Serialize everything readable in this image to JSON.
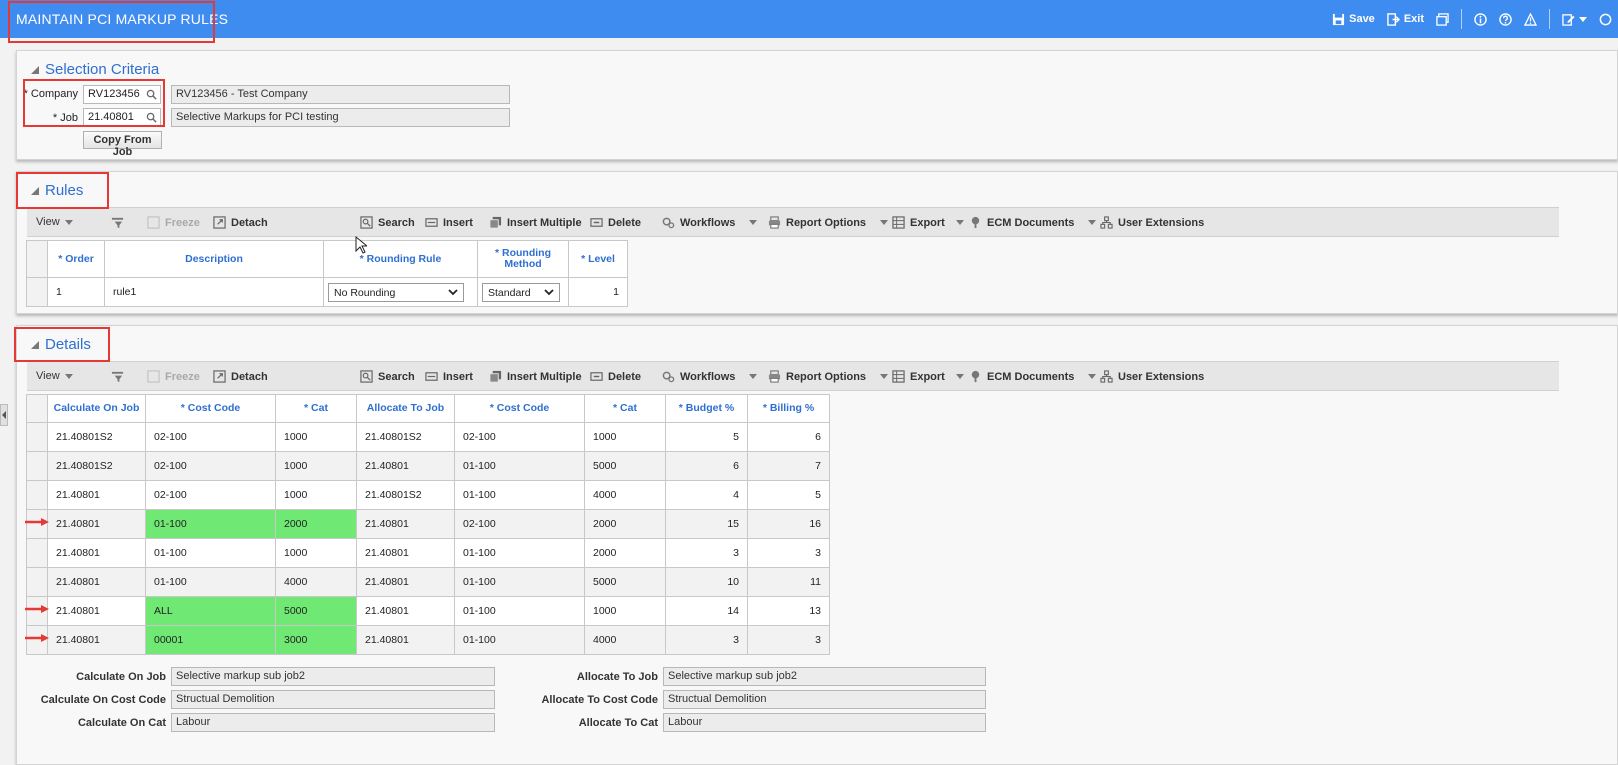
{
  "window": {
    "title": "MAINTAIN PCI MARKUP RULES",
    "actions": {
      "save": "Save",
      "exit": "Exit"
    }
  },
  "selection": {
    "title": "Selection Criteria",
    "company_label": "* Company",
    "company_value": "RV123456",
    "company_desc": "RV123456 - Test Company",
    "job_label": "* Job",
    "job_value": "21.40801",
    "job_desc": "Selective Markups for PCI testing",
    "copy_button": "Copy From Job"
  },
  "toolbar": {
    "view": "View",
    "freeze": "Freeze",
    "detach": "Detach",
    "search": "Search",
    "insert": "Insert",
    "insert_multiple": "Insert Multiple",
    "delete": "Delete",
    "workflows": "Workflows",
    "report_options": "Report Options",
    "export": "Export",
    "ecm_documents": "ECM Documents",
    "user_extensions": "User Extensions"
  },
  "rules": {
    "title": "Rules",
    "columns": [
      "* Order",
      "Description",
      "* Rounding Rule",
      "* Rounding Method",
      "* Level"
    ],
    "rows": [
      {
        "order": "1",
        "description": "rule1",
        "rounding_rule": "No Rounding",
        "rounding_method": "Standard",
        "level": "1"
      }
    ]
  },
  "details": {
    "title": "Details",
    "columns": [
      "Calculate On Job",
      "* Cost Code",
      "* Cat",
      "Allocate To Job",
      "* Cost Code",
      "* Cat",
      "* Budget %",
      "* Billing %"
    ],
    "rows": [
      {
        "calc_job": "21.40801S2",
        "calc_cost_code": "02-100",
        "calc_cat": "1000",
        "alloc_job": "21.40801S2",
        "alloc_cost_code": "02-100",
        "alloc_cat": "1000",
        "budget": "5",
        "billing": "6",
        "highlight": false,
        "arrow": false
      },
      {
        "calc_job": "21.40801S2",
        "calc_cost_code": "02-100",
        "calc_cat": "1000",
        "alloc_job": "21.40801",
        "alloc_cost_code": "01-100",
        "alloc_cat": "5000",
        "budget": "6",
        "billing": "7",
        "highlight": false,
        "arrow": false
      },
      {
        "calc_job": "21.40801",
        "calc_cost_code": "02-100",
        "calc_cat": "1000",
        "alloc_job": "21.40801S2",
        "alloc_cost_code": "01-100",
        "alloc_cat": "4000",
        "budget": "4",
        "billing": "5",
        "highlight": false,
        "arrow": false
      },
      {
        "calc_job": "21.40801",
        "calc_cost_code": "01-100",
        "calc_cat": "2000",
        "alloc_job": "21.40801",
        "alloc_cost_code": "02-100",
        "alloc_cat": "2000",
        "budget": "15",
        "billing": "16",
        "highlight": true,
        "arrow": true
      },
      {
        "calc_job": "21.40801",
        "calc_cost_code": "01-100",
        "calc_cat": "1000",
        "alloc_job": "21.40801",
        "alloc_cost_code": "01-100",
        "alloc_cat": "2000",
        "budget": "3",
        "billing": "3",
        "highlight": false,
        "arrow": false
      },
      {
        "calc_job": "21.40801",
        "calc_cost_code": "01-100",
        "calc_cat": "4000",
        "alloc_job": "21.40801",
        "alloc_cost_code": "01-100",
        "alloc_cat": "5000",
        "budget": "10",
        "billing": "11",
        "highlight": false,
        "arrow": false
      },
      {
        "calc_job": "21.40801",
        "calc_cost_code": "ALL",
        "calc_cat": "5000",
        "alloc_job": "21.40801",
        "alloc_cost_code": "01-100",
        "alloc_cat": "1000",
        "budget": "14",
        "billing": "13",
        "highlight": true,
        "arrow": true
      },
      {
        "calc_job": "21.40801",
        "calc_cost_code": "00001",
        "calc_cat": "3000",
        "alloc_job": "21.40801",
        "alloc_cost_code": "01-100",
        "alloc_cat": "4000",
        "budget": "3",
        "billing": "3",
        "highlight": true,
        "arrow": true
      }
    ],
    "footer": {
      "calc_job_label": "Calculate On Job",
      "calc_job_value": "Selective markup sub job2",
      "calc_cost_code_label": "Calculate On Cost Code",
      "calc_cost_code_value": "Structual Demolition",
      "calc_cat_label": "Calculate On Cat",
      "calc_cat_value": "Labour",
      "alloc_job_label": "Allocate To Job",
      "alloc_job_value": "Selective markup sub job2",
      "alloc_cost_code_label": "Allocate To Cost Code",
      "alloc_cost_code_value": "Structual Demolition",
      "alloc_cat_label": "Allocate To Cat",
      "alloc_cat_value": "Labour"
    }
  },
  "colors": {
    "title_bar": "#3f8cf0",
    "link_blue": "#2f6fd0",
    "highlight_green": "#70e874",
    "annotation_red": "#e53935"
  },
  "icons": [
    "save-icon",
    "exit-icon",
    "window-icon",
    "info-icon",
    "help-icon",
    "warning-icon",
    "edit-icon",
    "refresh-icon",
    "search-icon",
    "insert-icon",
    "delete-icon",
    "gear-icon",
    "print-icon",
    "export-icon",
    "ecm-icon",
    "extensions-icon"
  ]
}
